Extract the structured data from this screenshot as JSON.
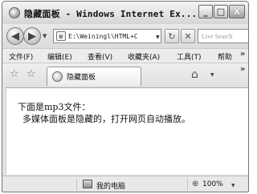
{
  "window": {
    "title": "隐藏面板 - Windows Internet Ex..."
  },
  "title_buttons": {
    "minimize": "_",
    "maximize": "□",
    "close": "X"
  },
  "navigation": {
    "back_glyph": "◀",
    "forward_glyph": "▶",
    "address": "E:\\Weiningl\\HTML+C",
    "search_placeholder": "Live Search"
  },
  "menu": {
    "items": [
      "文件(F)",
      "编辑(E)",
      "查看(V)",
      "收藏夹(A)",
      "工具(T)",
      "帮助"
    ],
    "overflow": "»"
  },
  "favorites": {
    "tab_label": "隐藏面板",
    "overflow": "»"
  },
  "content": {
    "line1": "下面是mp3文件：",
    "line2": "多媒体面板是隐藏的，打开网页自动播放。"
  },
  "status": {
    "zone": "我的电脑",
    "zoom": "100%"
  },
  "icons": {
    "ie_icon": "globe-icon",
    "favorites": "star-icon",
    "add_favorite": "star-add-icon",
    "home": "home-icon",
    "refresh": "refresh-icon",
    "stop": "stop-icon"
  }
}
